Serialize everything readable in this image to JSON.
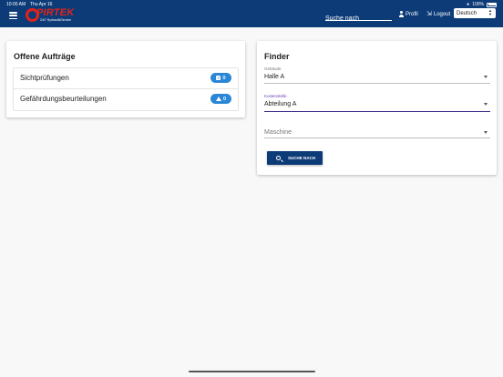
{
  "status_bar": {
    "time": "10:00 AM",
    "date": "Thu Apr 16",
    "battery": "100%"
  },
  "header": {
    "brand": "PIRTEK",
    "tagline": "24/7 HydraulikService",
    "search_placeholder": "Suche nach",
    "profil_label": "Profil",
    "logout_label": "Logout",
    "language_selected": "Deutsch",
    "background_color": "#0d3b78",
    "brand_color": "#e2231a"
  },
  "orders": {
    "title": "Offene Aufträge",
    "items": [
      {
        "label": "Sichtprüfungen",
        "count": "0",
        "icon": "checkbox-icon"
      },
      {
        "label": "Gefährdungsbeurteilungen",
        "count": "0",
        "icon": "warning-icon"
      }
    ]
  },
  "finder": {
    "title": "Finder",
    "fields": [
      {
        "label": "Gebäude",
        "value": "Halle A"
      },
      {
        "label": "Kostenstelle",
        "value": "Abteilung A"
      },
      {
        "label": "",
        "value": "Maschine"
      }
    ],
    "button_label": "SUCHE NACH"
  }
}
